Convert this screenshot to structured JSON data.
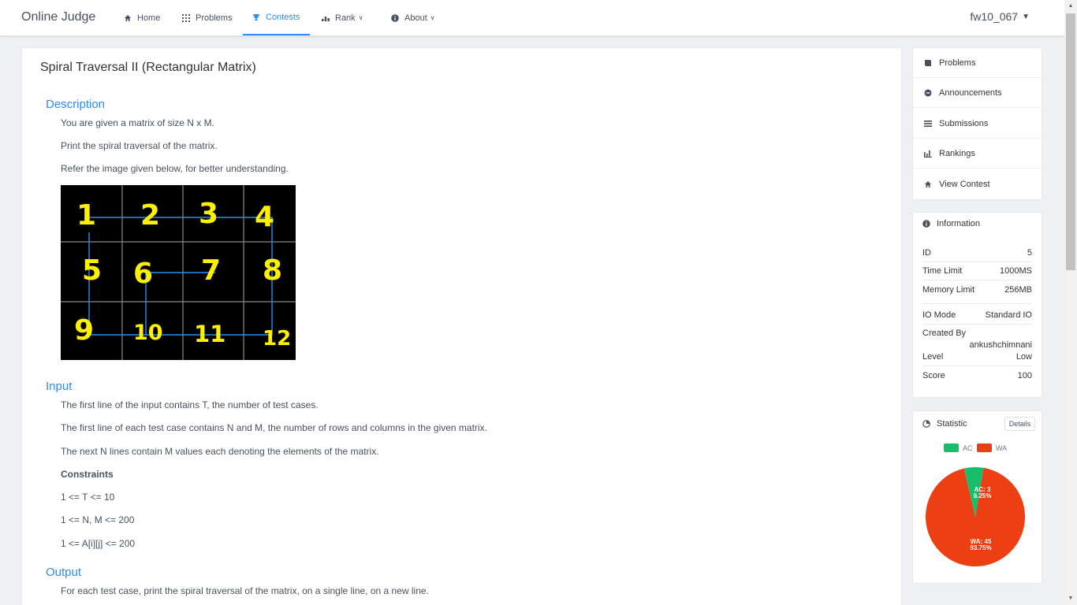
{
  "navbar": {
    "logo": "Online Judge",
    "items": [
      {
        "label": "Home",
        "icon": "home-icon"
      },
      {
        "label": "Problems",
        "icon": "grid-icon"
      },
      {
        "label": "Contests",
        "icon": "trophy-icon",
        "active": true
      },
      {
        "label": "Rank",
        "icon": "bar-chart-icon"
      },
      {
        "label": "About",
        "icon": "info-icon"
      }
    ],
    "user": "fw10_067",
    "accent": "#2d8cf0"
  },
  "problem": {
    "title": "Spiral Traversal II (Rectangular Matrix)",
    "description_title": "Description",
    "description": [
      "You are given a matrix of size N x M.",
      "Print the spiral traversal of the matrix.",
      "Refer the image given below, for better understanding."
    ],
    "matrix_numbers": [
      "1",
      "2",
      "3",
      "4",
      "5",
      "6",
      "7",
      "8",
      "9",
      "10",
      "11",
      "12"
    ],
    "input_title": "Input",
    "input": [
      "The first line of the input contains T, the number of test cases.",
      "The first line of each test case contains N and M, the number of rows and columns in the given matrix.",
      "The next N lines contain M values each denoting the elements of the matrix."
    ],
    "constraints_title": "Constraints",
    "constraints": [
      "1 <= T <= 10",
      "1 <= N, M <= 200",
      "1 <= A[i][j] <= 200"
    ],
    "output_title": "Output",
    "output": [
      "For each test case, print the spiral traversal of the matrix, on a single line, on a new line."
    ]
  },
  "sidebar": {
    "menu": [
      {
        "label": "Problems",
        "icon": "book-icon"
      },
      {
        "label": "Announcements",
        "icon": "chat-icon"
      },
      {
        "label": "Submissions",
        "icon": "list-icon"
      },
      {
        "label": "Rankings",
        "icon": "bar-chart-icon"
      },
      {
        "label": "View Contest",
        "icon": "home-icon"
      }
    ],
    "info": {
      "title": "Information",
      "rows": [
        {
          "k": "ID",
          "v": "5"
        },
        {
          "k": "Time Limit",
          "v": "1000MS"
        },
        {
          "k": "Memory Limit",
          "v": "256MB"
        },
        {
          "k": "IO Mode",
          "v": "Standard IO"
        },
        {
          "k": "Created By",
          "v": "ankushchimnani"
        },
        {
          "k": "Level",
          "v": "Low"
        },
        {
          "k": "Score",
          "v": "100"
        }
      ]
    },
    "statistic": {
      "title": "Statistic",
      "details_label": "Details",
      "legend": [
        {
          "label": "AC",
          "color": "#19be6b"
        },
        {
          "label": "WA",
          "color": "#ed3f14"
        }
      ],
      "ac_label": "AC: 3",
      "ac_pct": "6.25%",
      "wa_label": "WA: 45",
      "wa_pct": "93.75%"
    }
  },
  "chart_data": {
    "type": "pie",
    "categories": [
      "AC",
      "WA"
    ],
    "values": [
      3,
      45
    ],
    "percent_labels": [
      "6.25%",
      "93.75%"
    ],
    "colors": [
      "#19be6b",
      "#ed3f14"
    ]
  }
}
